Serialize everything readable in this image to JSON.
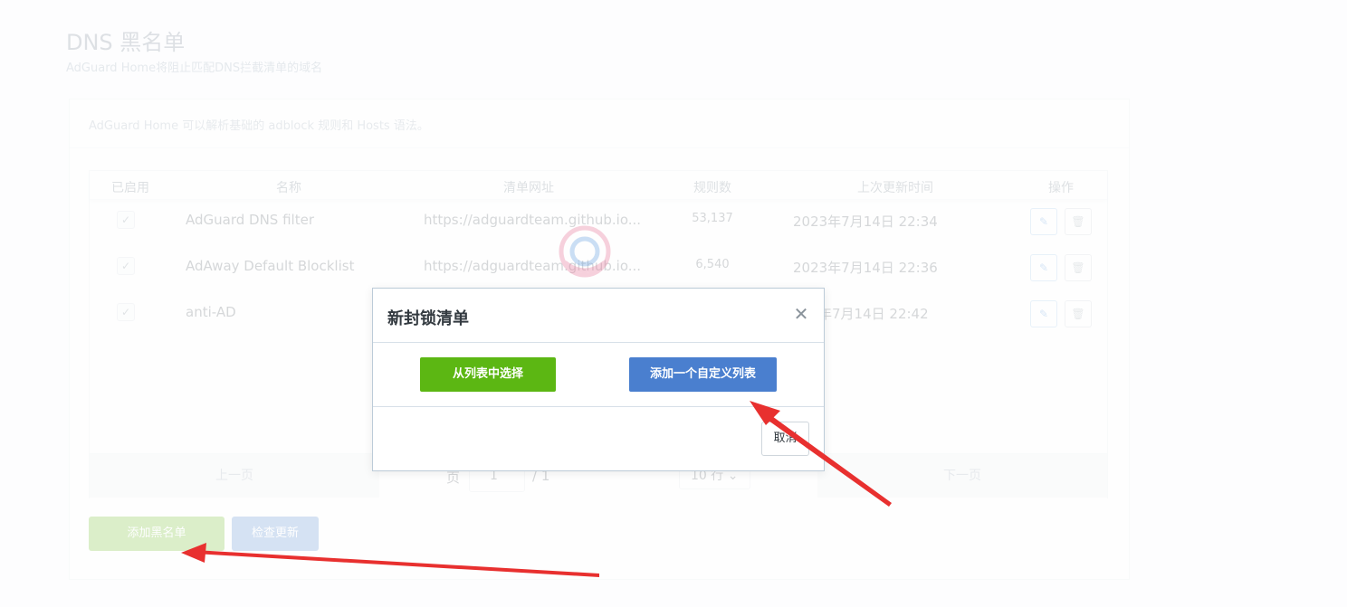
{
  "page": {
    "title": "DNS 黑名单",
    "subtitle": "AdGuard Home将阻止匹配DNS拦截清单的域名"
  },
  "card": {
    "header_text": "AdGuard Home 可以解析基础的 adblock 规则和 Hosts 语法。"
  },
  "table": {
    "columns": {
      "enabled": "已启用",
      "name": "名称",
      "url": "清单网址",
      "rules": "规则数",
      "updated": "上次更新时间",
      "actions": "操作"
    },
    "rows": [
      {
        "checked": "✓",
        "name": "AdGuard DNS filter",
        "url": "https://adguardteam.github.io...",
        "rules": "53,137",
        "updated": "2023年7月14日 22:34"
      },
      {
        "checked": "✓",
        "name": "AdAway Default Blocklist",
        "url": "https://adguardteam.github.io...",
        "rules": "6,540",
        "updated": "2023年7月14日 22:36"
      },
      {
        "checked": "✓",
        "name": "anti-AD",
        "url": "",
        "rules": "",
        "updated": "年7月14日 22:42"
      }
    ],
    "pagination": {
      "prev": "上一页",
      "page_label": "页",
      "current_page": "1",
      "total": "/ 1",
      "rows_per_page": "10 行",
      "next": "下一页"
    }
  },
  "buttons": {
    "add_blocklist": "添加黑名单",
    "check_updates": "检查更新"
  },
  "modal": {
    "title": "新封锁清单",
    "close_glyph": "✕",
    "choose_from_list": "从列表中选择",
    "add_custom_list": "添加一个自定义列表",
    "cancel": "取消"
  },
  "icons": {
    "edit": "edit-icon",
    "delete": "trash-icon",
    "close": "close-icon"
  },
  "colors": {
    "green": "#5cb713",
    "blue": "#4a7fcf",
    "arrow_red": "#e8302f"
  }
}
